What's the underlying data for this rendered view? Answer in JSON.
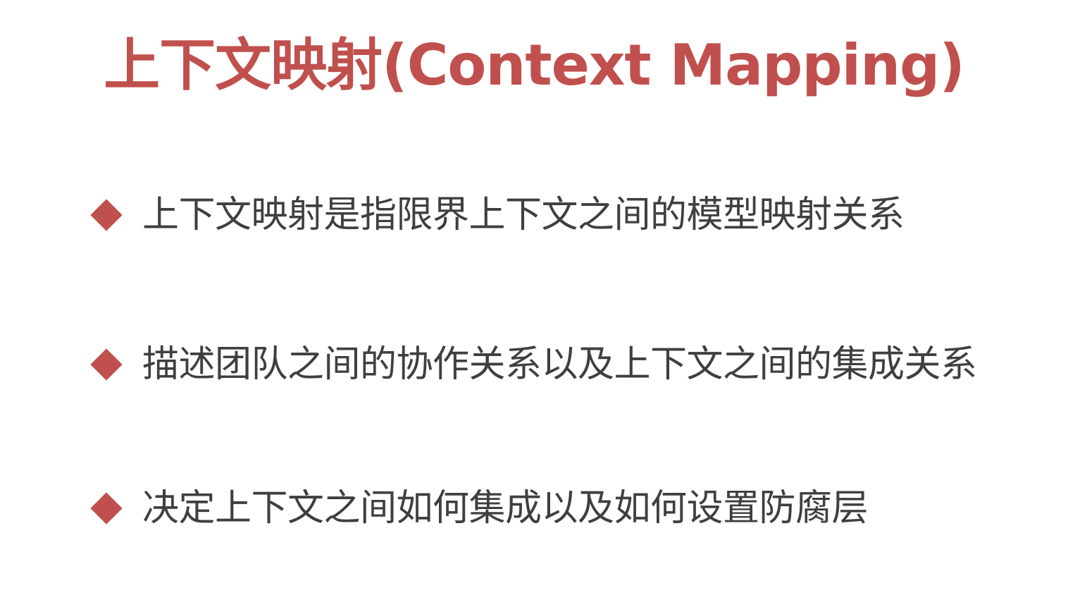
{
  "slide": {
    "title": "上下文映射(Context Mapping)",
    "bullets": [
      {
        "text": "上下文映射是指限界上下文之间的模型映射关系",
        "icon": "diamond-icon"
      },
      {
        "text": "描述团队之间的协作关系以及上下文之间的集成关系",
        "icon": "diamond-icon"
      },
      {
        "text": "决定上下文之间如何集成以及如何设置防腐层",
        "icon": "diamond-icon"
      }
    ]
  },
  "colors": {
    "title": "#c0504d",
    "bullet_marker": "#c0504d",
    "text": "#3f3f3f",
    "background": "#ffffff"
  }
}
